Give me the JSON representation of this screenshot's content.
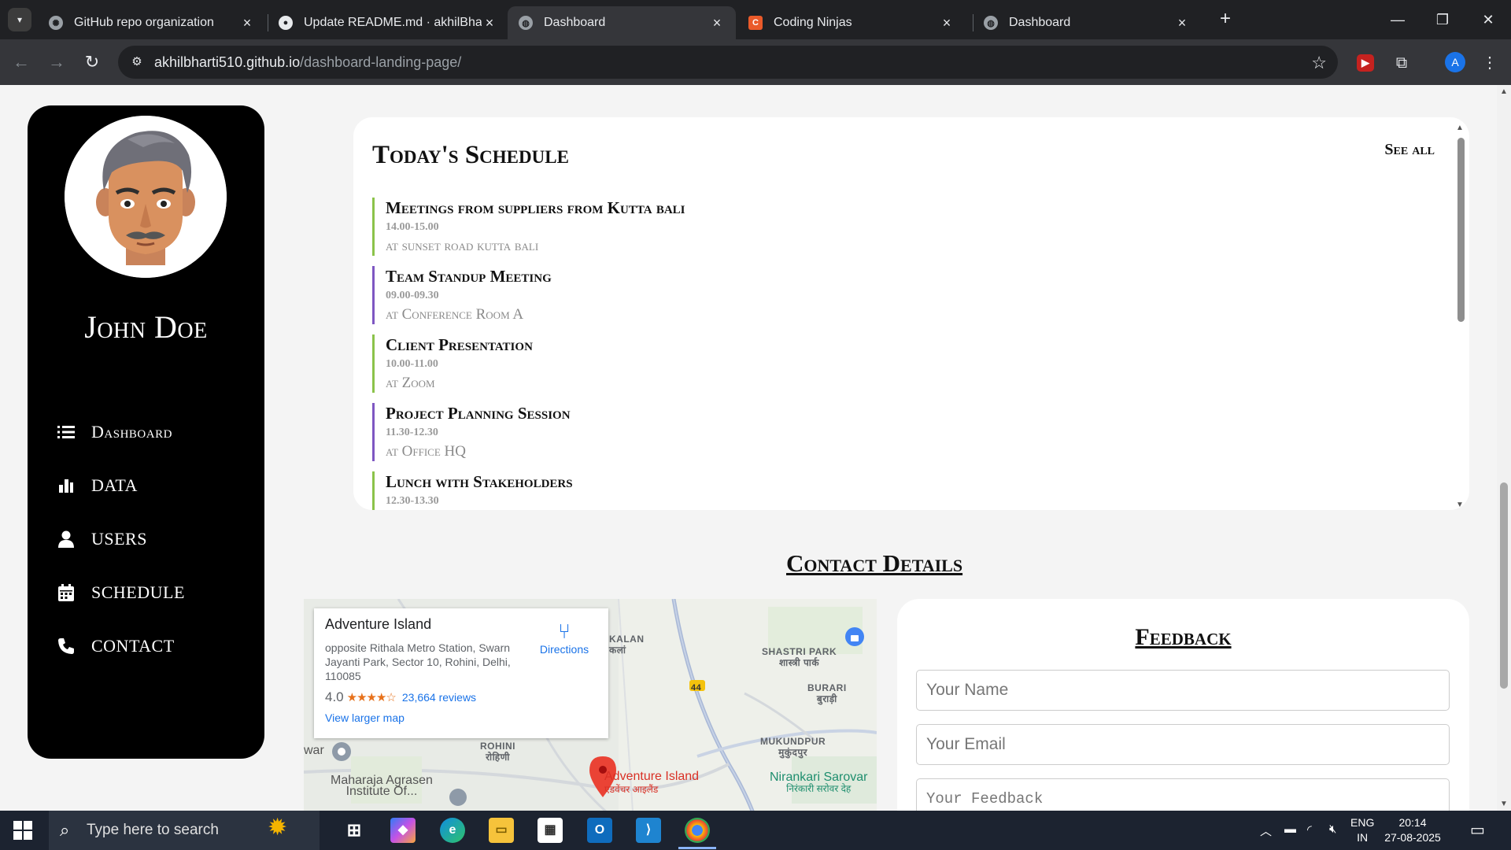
{
  "browser": {
    "tabs": [
      {
        "title": "GitHub repo organization",
        "favicon": "openai-icon",
        "active": false
      },
      {
        "title": "Update README.md · akhilBharti",
        "favicon": "github-icon",
        "active": false
      },
      {
        "title": "Dashboard",
        "favicon": "globe-icon",
        "active": true
      },
      {
        "title": "Coding Ninjas",
        "favicon": "coding-ninjas-icon",
        "active": false
      },
      {
        "title": "Dashboard",
        "favicon": "globe-icon",
        "active": false
      }
    ],
    "url_host": "akhilbharti510.github.io",
    "url_path": "/dashboard-landing-page/",
    "profile_initial": "A"
  },
  "sidebar": {
    "user_name": "John Doe",
    "nav": [
      {
        "label": "Dashboard",
        "icon": "list-icon"
      },
      {
        "label": "DATA",
        "icon": "bar-chart-icon"
      },
      {
        "label": "USERS",
        "icon": "user-icon"
      },
      {
        "label": "SCHEDULE",
        "icon": "calendar-icon"
      },
      {
        "label": "CONTACT",
        "icon": "phone-icon"
      }
    ]
  },
  "schedule": {
    "title": "Today's Schedule",
    "see_all": "See all",
    "items": [
      {
        "title": "Meetings from suppliers from Kutta bali",
        "time": "14.00-15.00",
        "location": "at sunset road kutta bali",
        "accent": "#8bc34a"
      },
      {
        "title": "Team Standup Meeting",
        "time": "09.00-09.30",
        "location": "at Conference Room A",
        "accent": "#7e57c2"
      },
      {
        "title": "Client Presentation",
        "time": "10.00-11.00",
        "location": "at Zoom",
        "accent": "#8bc34a"
      },
      {
        "title": "Project Planning Session",
        "time": "11.30-12.30",
        "location": "at Office HQ",
        "accent": "#7e57c2"
      },
      {
        "title": "Lunch with Stakeholders",
        "time": "12.30-13.30",
        "location": "",
        "accent": "#8bc34a"
      }
    ]
  },
  "contact": {
    "heading": "Contact Details",
    "map": {
      "place_name": "Adventure Island",
      "address": "opposite Rithala Metro Station, Swarn Jayanti Park, Sector 10, Rohini, Delhi, 110085",
      "rating": "4.0",
      "stars": "★★★★☆",
      "reviews": "23,664 reviews",
      "view_larger": "View larger map",
      "directions": "Directions",
      "labels": {
        "kalan": "KALAN\nकलां",
        "shastri_park": "SHASTRI PARK\nशास्त्री पार्क",
        "burari": "BURARI\nबुराड़ी",
        "rohini": "ROHINI\nरोहिणी",
        "mukundpur": "MUKUNDPUR\nमुकुंदपुर",
        "maharaja": "Maharaja Agrasen\nInstitute Of...",
        "nirankari": "Nirankari Sarovar\nनिरंकारी सरोवर देह",
        "pin_name": "Adventure Island",
        "pin_hindi": "एडवेंचर आइलैंड",
        "road_44": "44",
        "war": "war"
      }
    },
    "feedback": {
      "title": "Feedback",
      "name_placeholder": "Your Name",
      "email_placeholder": "Your Email",
      "feedback_placeholder": "Your Feedback"
    }
  },
  "taskbar": {
    "search_placeholder": "Type here to search",
    "lang_top": "ENG",
    "lang_bottom": "IN",
    "time": "20:14",
    "date": "27-08-2025"
  }
}
